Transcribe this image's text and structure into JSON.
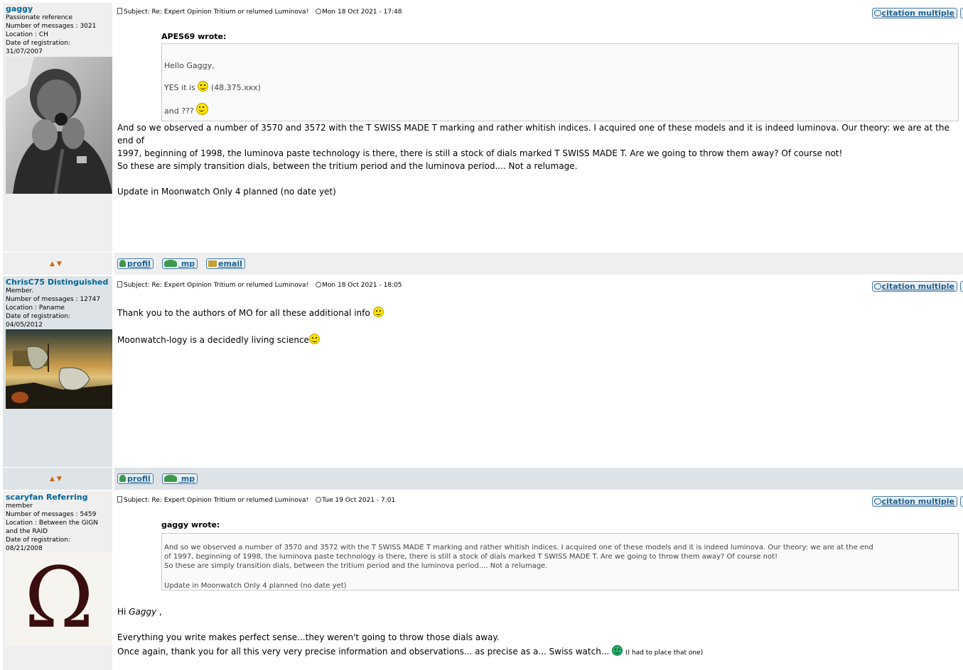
{
  "posts": [
    {
      "username": "gaggy",
      "rank": "Passionate reference",
      "messages": "Number of messages : 3021",
      "location": "Location : CH",
      "registration_label": "Date of registration:",
      "registration_date": "31/07/2007",
      "subject": "Subject: Re: Expert Opinion Tritium or relumed Luminova!",
      "date": "Mon 18 Oct 2021 - 17:48",
      "cite_label": "citation multiple",
      "quote_author": "APES69 wrote:",
      "quote_lines": [
        "Hello Gaggy,",
        "YES it is",
        "(48.375.xxx)",
        "and ???"
      ],
      "body": [
        "And so we observed a number of 3570 and 3572 with the T SWISS MADE T marking and rather whitish indices. I acquired one of these models and it is indeed luminova. Our theory: we are at the end of",
        "1997, beginning of 1998, the luminova paste technology is there, there is still a stock of dials marked T SWISS MADE T. Are we going to throw them away? Of course not!",
        "So these are simply transition dials, between the tritium period and the luminova period.... Not a relumage.",
        "Update in Moonwatch Only 4 planned (no date yet)"
      ],
      "buttons": [
        "profil",
        "mp",
        "email"
      ]
    },
    {
      "username": "ChrisC75 Distinguished",
      "rank": "Member.",
      "messages": "Number of messages : 12747",
      "location": "Location : Paname",
      "registration_label": "Date of registration:",
      "registration_date": "04/05/2012",
      "subject": "Subject: Re: Expert Opinion Tritium or relumed Luminova!",
      "date": "Mon 18 Oct 2021 - 18:05",
      "cite_label": "citation multiple",
      "body": [
        "Thank you to the authors of MO for all these additional info",
        "Moonwatch-logy is a decidedly living science"
      ],
      "buttons": [
        "profil",
        "mp"
      ]
    },
    {
      "username": "scaryfan Referring",
      "rank": "member",
      "messages": "Number of messages : 5459",
      "location_line1": "Location : Between the GIGN",
      "location_line2": "and the RAID",
      "registration_label": "Date of registration:",
      "registration_date": "08/21/2008",
      "subject": "Subject: Re: Expert Opinion Tritium or relumed Luminova!",
      "date": "Tue 19 Oct 2021 - 7:01",
      "cite_label": "citation multiple",
      "quote_author": "gaggy wrote:",
      "quote_lines": [
        "And so we observed a number of 3570 and 3572 with the T SWISS MADE T marking and rather whitish indices. I acquired one of these models and it is indeed luminova. Our theory: we are at the end",
        "of 1997, beginning of 1998, the luminova paste technology is there, there is still a stock of dials marked T SWISS MADE T. Are we going to throw them away? Of course not!",
        "So these are simply transition dials, between the tritium period and the luminova period.... Not a relumage.",
        "Update in Moonwatch Only 4 planned (no date yet)"
      ],
      "greeting_prefix": "Hi",
      "greeting_name": "Gaggy",
      "greeting_suffix": ",",
      "body": [
        "Everything you write makes perfect sense...they weren't going to throw those dials away.",
        "Once again, thank you for all this very very precise information and observations... as precise as a... Swiss watch...",
        "(I had to place that one)"
      ],
      "avatar_glyph": "Ω"
    }
  ],
  "colors": {
    "odd_row": "#efefef",
    "even_row": "#dee3e7",
    "username": "#006699",
    "button": "#1f5f8f"
  },
  "icons": [
    "doc-icon",
    "clock-icon",
    "quote-icon",
    "profile-icon",
    "pm-icon",
    "email-icon",
    "arrow-up-icon",
    "arrow-down-icon",
    "smiley-icon"
  ]
}
